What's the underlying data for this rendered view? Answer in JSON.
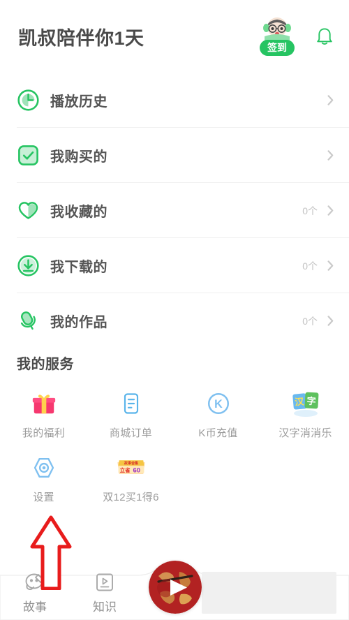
{
  "header": {
    "title": "凯叔陪伴你1天",
    "checkin_label": "签到",
    "checkin_icon": "avatar-character-icon",
    "bell_icon": "bell-icon"
  },
  "list": {
    "items": [
      {
        "label": "播放历史",
        "count": "",
        "icon": "clock-icon"
      },
      {
        "label": "我购买的",
        "count": "",
        "icon": "check-square-icon"
      },
      {
        "label": "我收藏的",
        "count": "0个",
        "icon": "heart-icon"
      },
      {
        "label": "我下载的",
        "count": "0个",
        "icon": "download-circle-icon"
      },
      {
        "label": "我的作品",
        "count": "0个",
        "icon": "microphone-icon"
      }
    ]
  },
  "services": {
    "title": "我的服务",
    "tiles": [
      {
        "label": "我的福利",
        "icon": "gift-icon"
      },
      {
        "label": "商城订单",
        "icon": "order-document-icon"
      },
      {
        "label": "K币充值",
        "icon": "k-coin-icon"
      },
      {
        "label": "汉字消消乐",
        "icon": "hanzi-game-icon"
      },
      {
        "label": "设置",
        "icon": "settings-hexagon-icon"
      },
      {
        "label": "双12买1得6",
        "icon": "promo-banner-icon"
      }
    ]
  },
  "promo": {
    "top_text": "故事合集",
    "main_text": "立省",
    "number": "60"
  },
  "tabbar": {
    "tabs": [
      {
        "label": "故事",
        "icon": "story-ghost-icon"
      },
      {
        "label": "知识",
        "icon": "knowledge-play-icon"
      }
    ],
    "player_icon": "play-button-icon"
  },
  "annotation": {
    "arrow_icon": "up-arrow-annotation-icon"
  },
  "colors": {
    "green": "#26c462",
    "green_light": "#9fe3b9",
    "text_dark": "#4a4a4a",
    "text_gray": "#9b9b9b",
    "pink": "#f6386f",
    "blue": "#7fc0f0",
    "red_annot": "#e81c1c"
  }
}
